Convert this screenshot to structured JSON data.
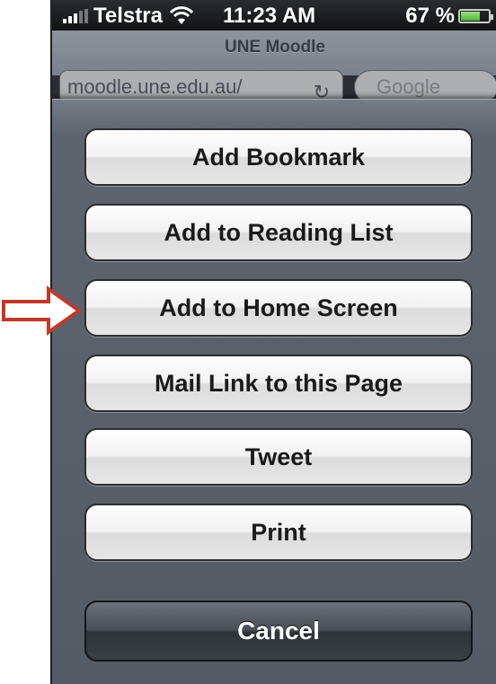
{
  "status_bar": {
    "carrier": "Telstra",
    "time": "11:23 AM",
    "battery": "67 %"
  },
  "browser": {
    "page_title": "UNE Moodle",
    "url": "moodle.une.edu.au/",
    "search_placeholder": "Google"
  },
  "action_sheet": {
    "buttons": [
      "Add Bookmark",
      "Add to Reading List",
      "Add to Home Screen",
      "Mail Link to this Page",
      "Tweet",
      "Print"
    ],
    "cancel": "Cancel"
  },
  "annotation": {
    "arrow_color": "#c0392b",
    "target": "Add to Home Screen"
  },
  "icons": [
    "signal-icon",
    "wifi-icon",
    "battery-icon",
    "reload-icon",
    "arrow-icon"
  ]
}
